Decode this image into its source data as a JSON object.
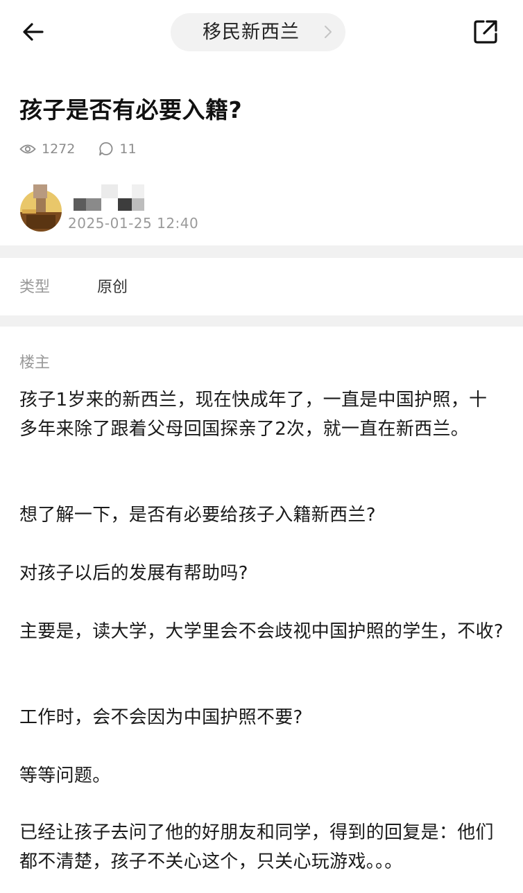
{
  "header": {
    "forum_name": "移民新西兰"
  },
  "post": {
    "title": "孩子是否有必要入籍?",
    "views": "1272",
    "comments": "11",
    "date": "2025-01-25 12:40",
    "type_label": "类型",
    "type_value": "原创",
    "op_label": "楼主",
    "paragraphs": [
      "孩子1岁来的新西兰，现在快成年了，一直是中国护照，十多年来除了跟着父母回国探亲了2次，就一直在新西兰。",
      "想了解一下，是否有必要给孩子入籍新西兰?",
      "对孩子以后的发展有帮助吗?",
      "主要是，读大学，大学里会不会歧视中国护照的学生，不收?",
      "工作时，会不会因为中国护照不要?",
      "等等问题。",
      "已经让孩子去问了他的好朋友和同学，得到的回复是：他们都不清楚，孩子不关心这个，只关心玩游戏。。。"
    ]
  },
  "icons": {
    "back": "back-arrow-icon",
    "chevron": "chevron-right-icon",
    "share": "share-external-icon",
    "views": "eye-icon",
    "comments": "comment-icon"
  }
}
